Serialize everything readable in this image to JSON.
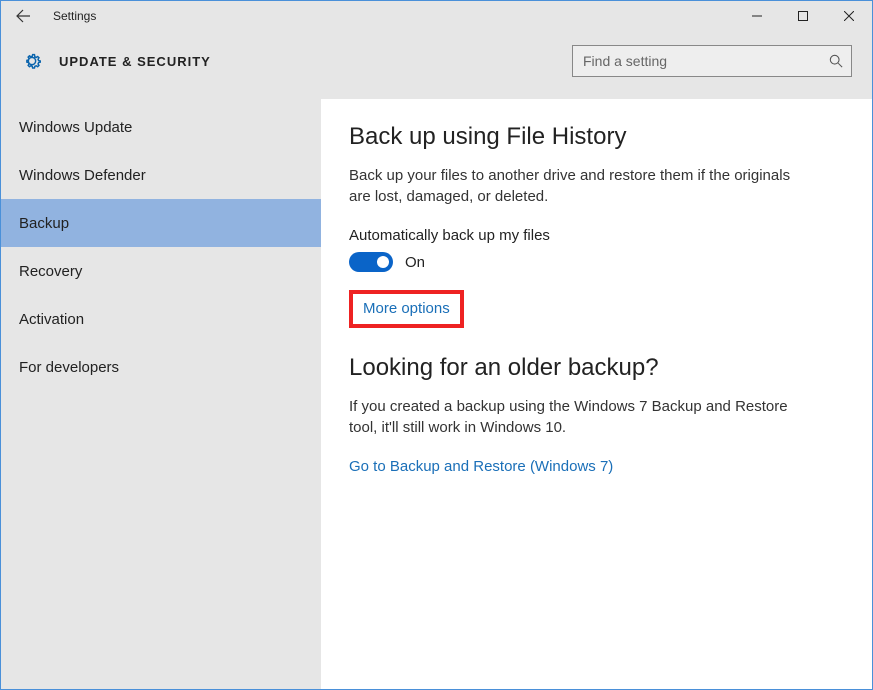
{
  "window": {
    "title": "Settings"
  },
  "header": {
    "title": "UPDATE & SECURITY",
    "search_placeholder": "Find a setting"
  },
  "sidebar": {
    "items": [
      {
        "label": "Windows Update",
        "selected": false
      },
      {
        "label": "Windows Defender",
        "selected": false
      },
      {
        "label": "Backup",
        "selected": true
      },
      {
        "label": "Recovery",
        "selected": false
      },
      {
        "label": "Activation",
        "selected": false
      },
      {
        "label": "For developers",
        "selected": false
      }
    ]
  },
  "content": {
    "section1_title": "Back up using File History",
    "section1_desc": "Back up your files to another drive and restore them if the originals are lost, damaged, or deleted.",
    "toggle_label": "Automatically back up my files",
    "toggle_state": "On",
    "more_options": "More options",
    "section2_title": "Looking for an older backup?",
    "section2_desc": "If you created a backup using the Windows 7 Backup and Restore tool, it'll still work in Windows 10.",
    "legacy_link": "Go to Backup and Restore (Windows 7)"
  }
}
